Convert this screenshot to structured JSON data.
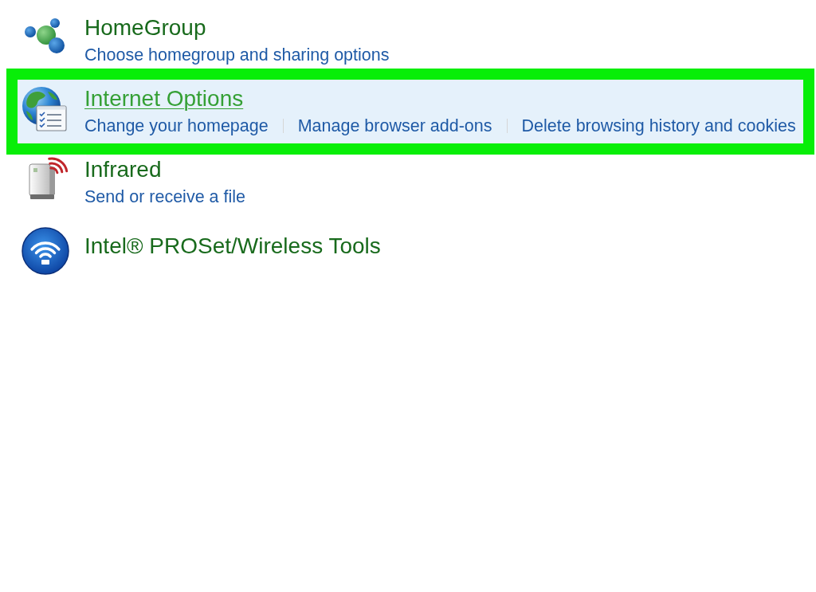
{
  "items": [
    {
      "title": "HomeGroup",
      "hovered": false,
      "highlighted": false,
      "links": [
        "Choose homegroup and sharing options"
      ]
    },
    {
      "title": "Internet Options",
      "hovered": true,
      "highlighted": true,
      "links": [
        "Change your homepage",
        "Manage browser add-ons",
        "Delete browsing history and cookies"
      ]
    },
    {
      "title": "Infrared",
      "hovered": false,
      "highlighted": false,
      "links": [
        "Send or receive a file"
      ]
    },
    {
      "title": "Intel® PROSet/Wireless Tools",
      "hovered": false,
      "highlighted": false
    }
  ]
}
